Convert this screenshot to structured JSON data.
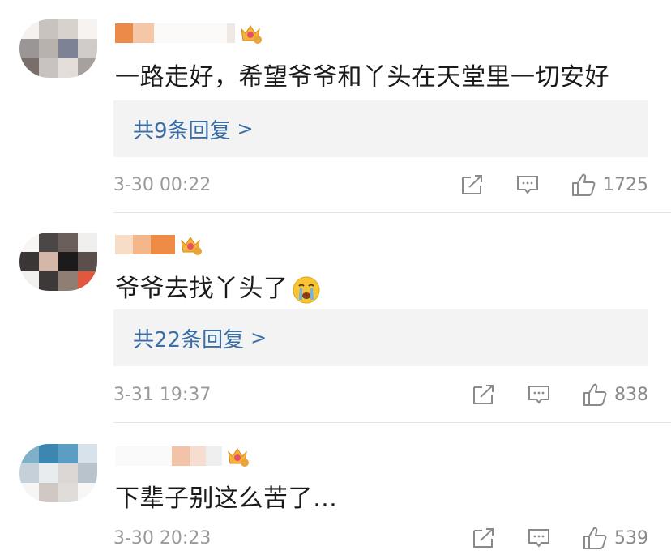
{
  "comments": [
    {
      "text": "一路走好，希望爷爷和丫头在天堂里一切安好",
      "reply_count_text": "共9条回复",
      "reply_chevron": ">",
      "time": "3-30 00:22",
      "likes": "1725",
      "vip_level": "2"
    },
    {
      "text": "爷爷去找丫头了",
      "emoji": "crying-face",
      "reply_count_text": "共22条回复",
      "reply_chevron": ">",
      "time": "3-31 19:37",
      "likes": "838",
      "vip_level": "6"
    },
    {
      "text": "下辈子别这么苦了…",
      "time": "3-30 20:23",
      "likes": "539",
      "vip_level": "5"
    }
  ],
  "icons": {
    "share": "share-icon",
    "comment": "comment-icon",
    "like": "thumbs-up-icon",
    "vip": "crown-badge-icon"
  },
  "colors": {
    "reply_link": "#3a6ea8",
    "muted": "#9a9a9a",
    "vip_gold": "#e8a33a"
  }
}
